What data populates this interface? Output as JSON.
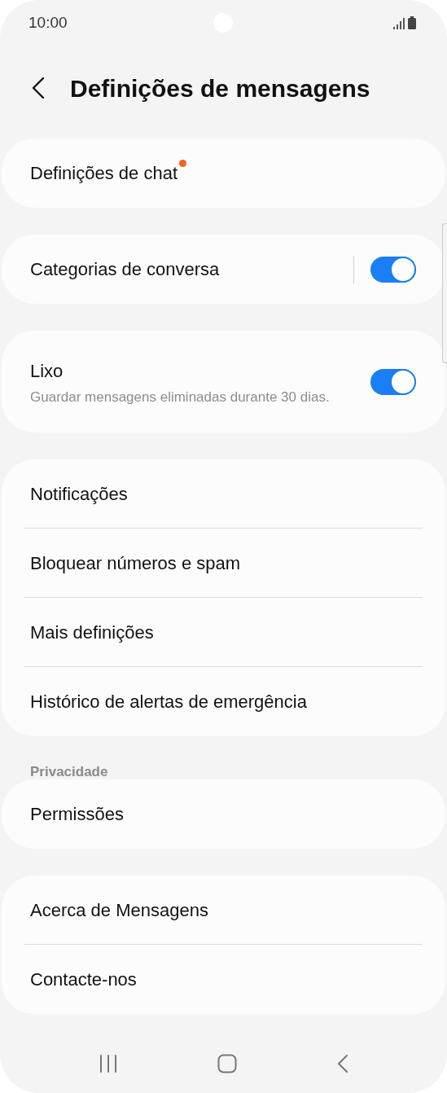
{
  "status_bar": {
    "time": "10:00"
  },
  "header": {
    "title": "Definições de mensagens"
  },
  "groups": [
    {
      "items": [
        {
          "kind": "link",
          "label": "Definições de chat",
          "new_dot": true
        }
      ]
    },
    {
      "items": [
        {
          "kind": "split_switch",
          "label": "Categorias de conversa",
          "on": true
        }
      ]
    },
    {
      "items": [
        {
          "kind": "switch",
          "label": "Lixo",
          "subtitle": "Guardar mensagens eliminadas durante 30 dias.",
          "on": true
        }
      ]
    },
    {
      "items": [
        {
          "kind": "link",
          "label": "Notificações",
          "new_dot": false
        },
        {
          "kind": "link",
          "label": "Bloquear números e spam",
          "new_dot": false
        },
        {
          "kind": "link",
          "label": "Mais definições",
          "new_dot": false
        },
        {
          "kind": "link",
          "label": "Histórico de alertas de emergência",
          "new_dot": false
        }
      ]
    },
    {
      "header": "Privacidade",
      "items": [
        {
          "kind": "link",
          "label": "Permissões",
          "new_dot": false
        }
      ]
    },
    {
      "items": [
        {
          "kind": "link",
          "label": "Acerca de Mensagens",
          "new_dot": false
        },
        {
          "kind": "link",
          "label": "Contacte-nos",
          "new_dot": false
        }
      ]
    }
  ]
}
